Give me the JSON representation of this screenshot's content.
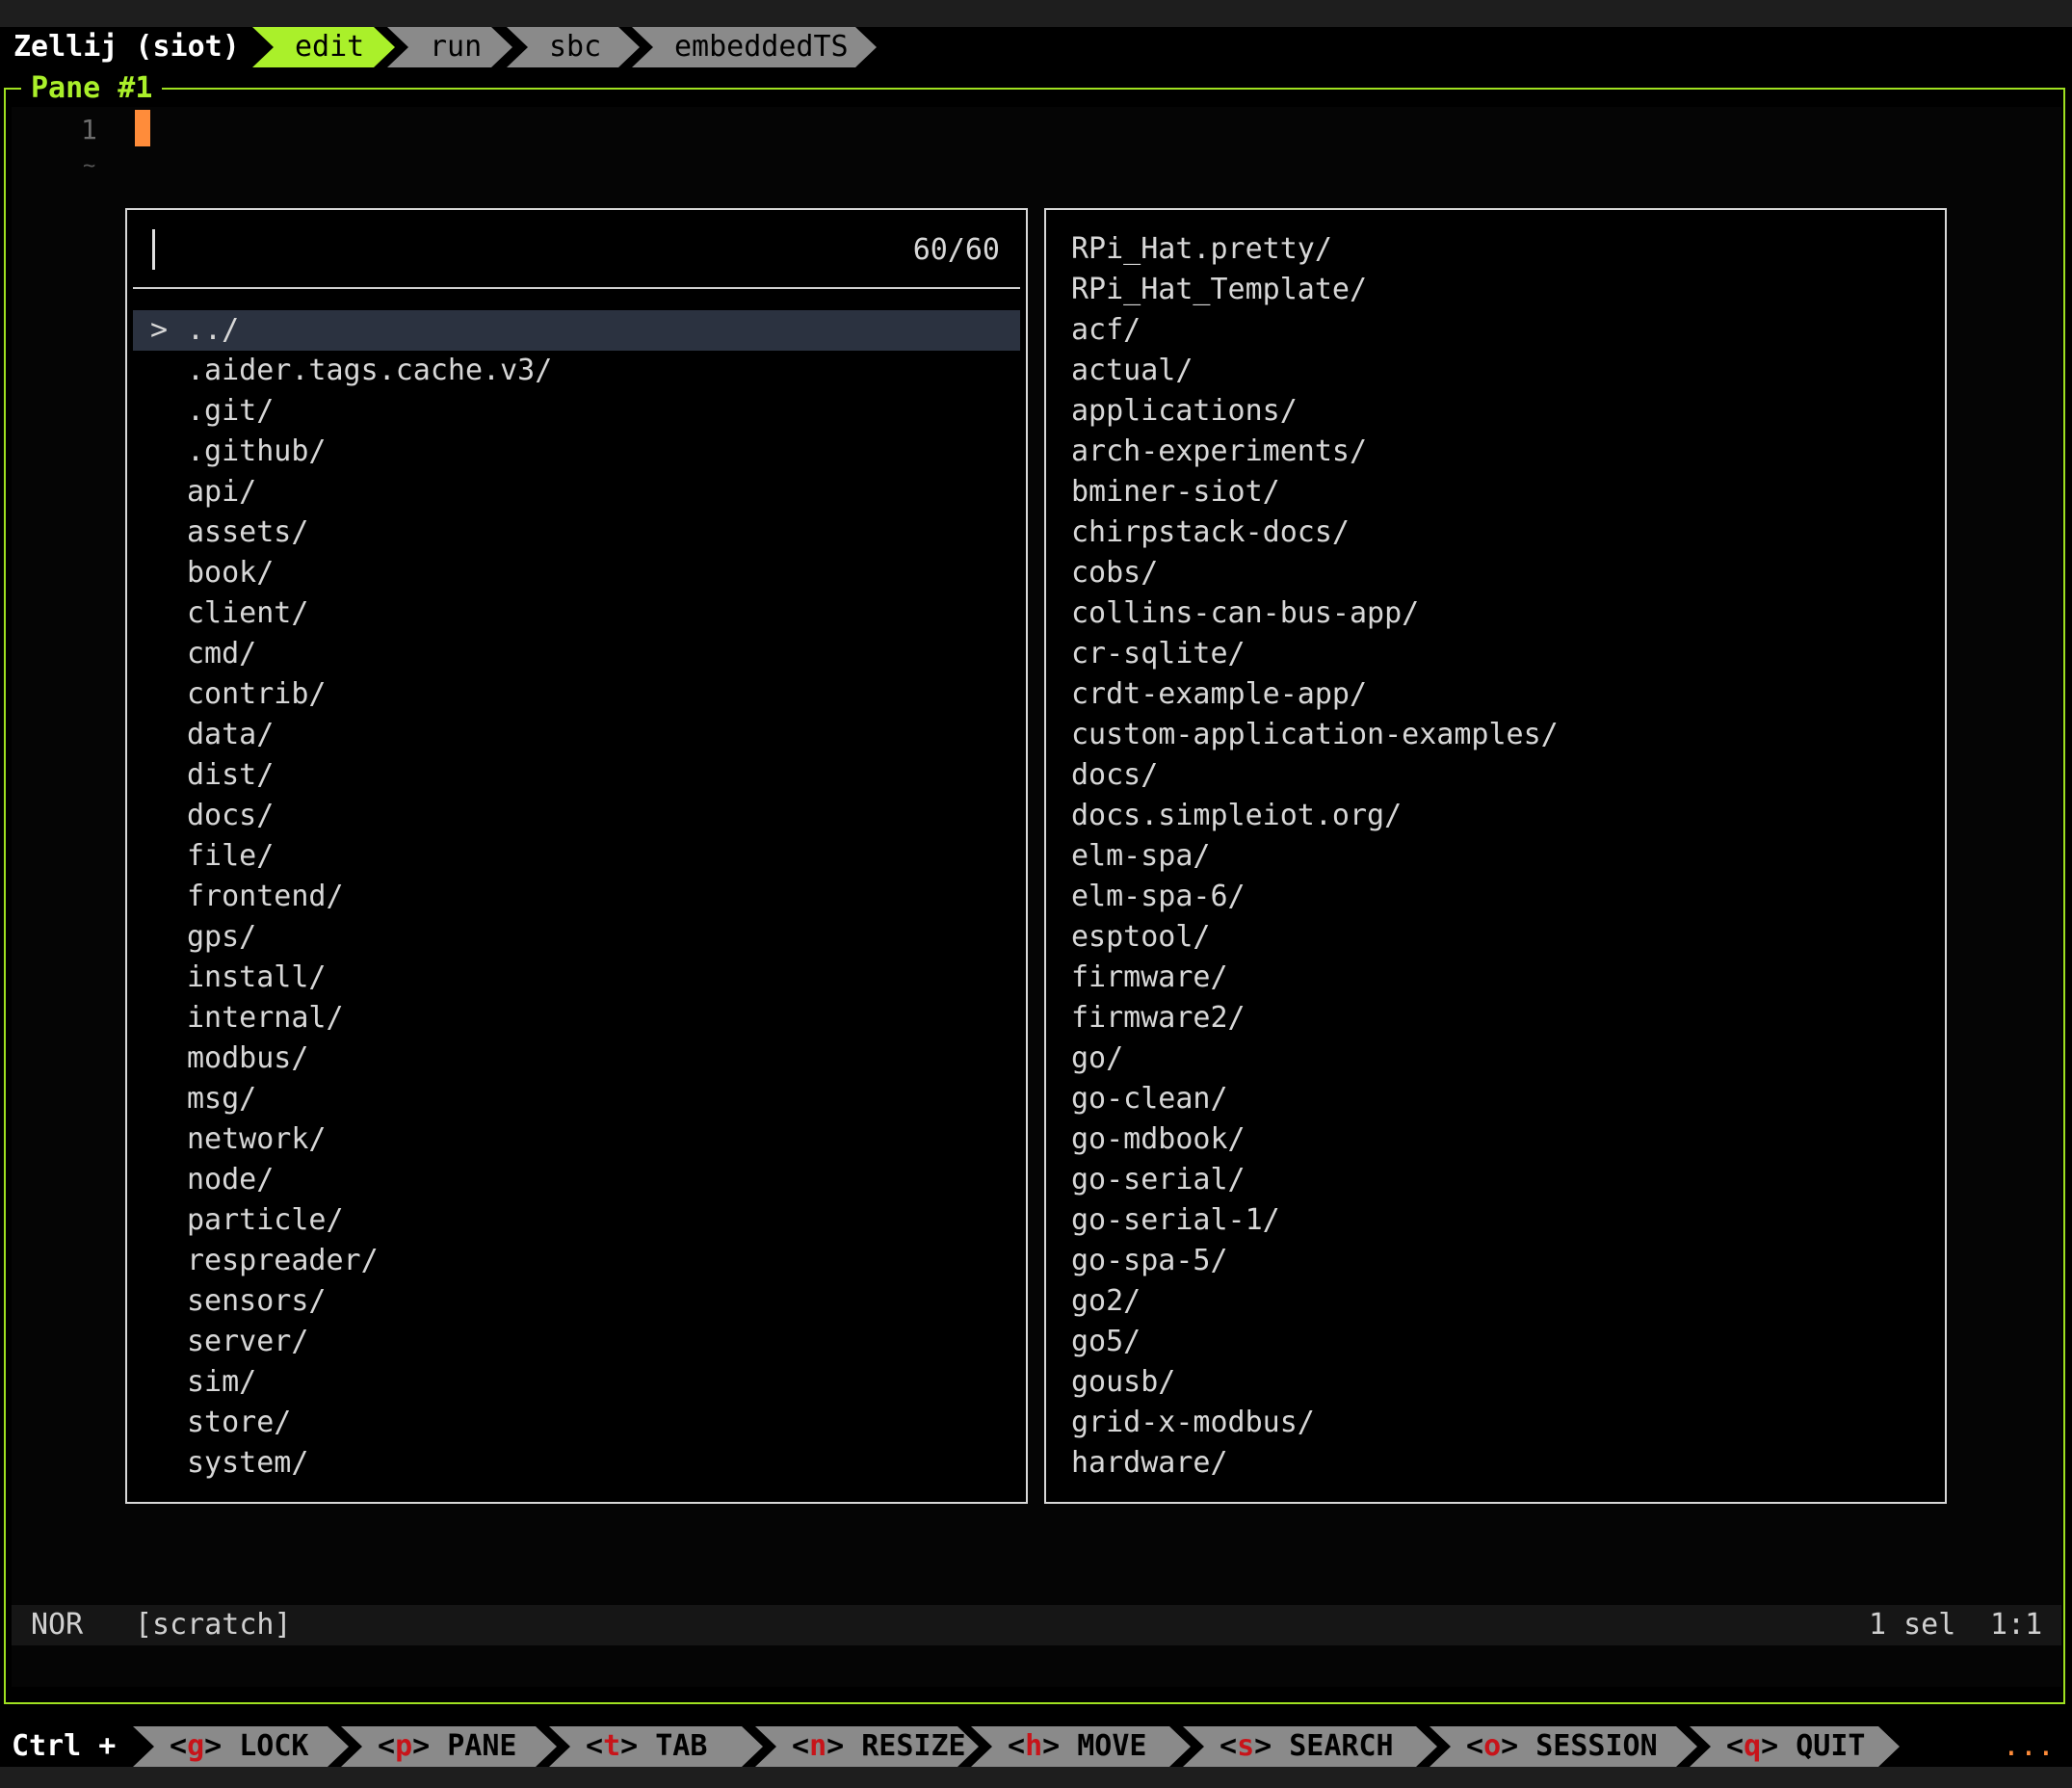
{
  "tabbar": {
    "app_title": "Zellij (siot)",
    "tabs": [
      {
        "label": "edit",
        "active": true
      },
      {
        "label": "run",
        "active": false
      },
      {
        "label": "sbc",
        "active": false
      },
      {
        "label": "embeddedTS",
        "active": false
      }
    ]
  },
  "pane": {
    "title": "Pane #1"
  },
  "editor": {
    "line_number": "1",
    "tilde": "~",
    "cursor_color": "#ff8c3a"
  },
  "picker": {
    "query": "",
    "count": "60/60",
    "selected_marker": ">",
    "items": [
      "../",
      ".aider.tags.cache.v3/",
      ".git/",
      ".github/",
      "api/",
      "assets/",
      "book/",
      "client/",
      "cmd/",
      "contrib/",
      "data/",
      "dist/",
      "docs/",
      "file/",
      "frontend/",
      "gps/",
      "install/",
      "internal/",
      "modbus/",
      "msg/",
      "network/",
      "node/",
      "particle/",
      "respreader/",
      "sensors/",
      "server/",
      "sim/",
      "store/",
      "system/"
    ]
  },
  "preview": {
    "items": [
      "RPi_Hat.pretty/",
      "RPi_Hat_Template/",
      "acf/",
      "actual/",
      "applications/",
      "arch-experiments/",
      "bminer-siot/",
      "chirpstack-docs/",
      "cobs/",
      "collins-can-bus-app/",
      "cr-sqlite/",
      "crdt-example-app/",
      "custom-application-examples/",
      "docs/",
      "docs.simpleiot.org/",
      "elm-spa/",
      "elm-spa-6/",
      "esptool/",
      "firmware/",
      "firmware2/",
      "go/",
      "go-clean/",
      "go-mdbook/",
      "go-serial/",
      "go-serial-1/",
      "go-spa-5/",
      "go2/",
      "go5/",
      "gousb/",
      "grid-x-modbus/",
      "hardware/"
    ]
  },
  "statusline": {
    "mode": "NOR",
    "buffer": "[scratch]",
    "selections": "1 sel",
    "position": "1:1"
  },
  "keybar": {
    "prefix": "Ctrl +",
    "keys": [
      {
        "key": "g",
        "label": "LOCK"
      },
      {
        "key": "p",
        "label": "PANE"
      },
      {
        "key": "t",
        "label": "TAB"
      },
      {
        "key": "n",
        "label": "RESIZE"
      },
      {
        "key": "h",
        "label": "MOVE"
      },
      {
        "key": "s",
        "label": "SEARCH"
      },
      {
        "key": "o",
        "label": "SESSION"
      },
      {
        "key": "q",
        "label": "QUIT"
      }
    ],
    "overflow": "..."
  },
  "colors": {
    "accent_green": "#aaf02a",
    "frame_green": "#9fe020",
    "key_red": "#c8141a",
    "tab_gray": "#8a8a8a",
    "selection_bg": "#2b3240"
  }
}
